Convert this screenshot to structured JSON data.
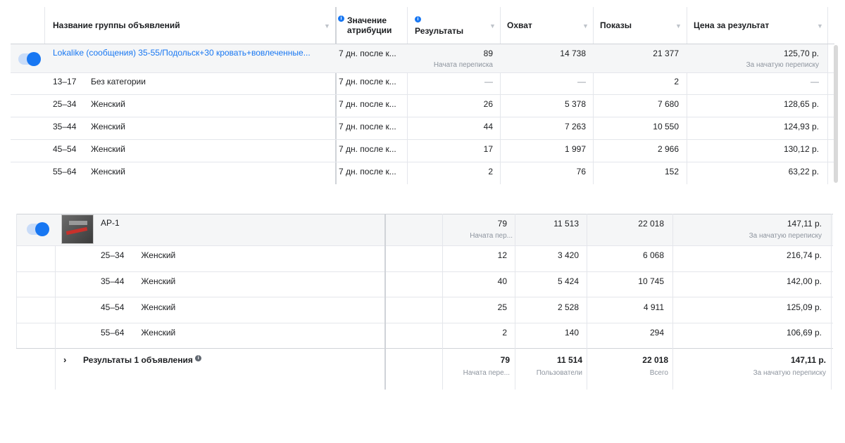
{
  "top_table": {
    "headers": {
      "name": "Название группы объявлений",
      "attribution": "Значение атрибуции",
      "results": "Результаты",
      "reach": "Охват",
      "impressions": "Показы",
      "cost": "Цена за результат"
    },
    "main_row": {
      "name": "Lokalike (сообщения) 35-55/Подольск+30 кровать+вовлеченные...",
      "attribution": "7 дн. после к...",
      "results": "89",
      "results_sub": "Начата переписка",
      "reach": "14 738",
      "impressions": "21 377",
      "cost": "125,70 р.",
      "cost_sub": "За начатую переписку"
    },
    "rows": [
      {
        "age": "13–17",
        "gender": "Без категории",
        "attribution": "7 дн. после к...",
        "results": "—",
        "reach": "—",
        "impressions": "2",
        "cost": "—"
      },
      {
        "age": "25–34",
        "gender": "Женский",
        "attribution": "7 дн. после к...",
        "results": "26",
        "reach": "5 378",
        "impressions": "7 680",
        "cost": "128,65 р."
      },
      {
        "age": "35–44",
        "gender": "Женский",
        "attribution": "7 дн. после к...",
        "results": "44",
        "reach": "7 263",
        "impressions": "10 550",
        "cost": "124,93 р."
      },
      {
        "age": "45–54",
        "gender": "Женский",
        "attribution": "7 дн. после к...",
        "results": "17",
        "reach": "1 997",
        "impressions": "2 966",
        "cost": "130,12 р."
      },
      {
        "age": "55–64",
        "gender": "Женский",
        "attribution": "7 дн. после к...",
        "results": "2",
        "reach": "76",
        "impressions": "152",
        "cost": "63,22 р."
      }
    ]
  },
  "bottom_table": {
    "main_row": {
      "name": "AP-1",
      "results": "79",
      "results_sub": "Начата пер...",
      "reach": "11 513",
      "impressions": "22 018",
      "cost": "147,11 р.",
      "cost_sub": "За начатую переписку"
    },
    "rows": [
      {
        "age": "25–34",
        "gender": "Женский",
        "results": "12",
        "reach": "3 420",
        "impressions": "6 068",
        "cost": "216,74 р."
      },
      {
        "age": "35–44",
        "gender": "Женский",
        "results": "40",
        "reach": "5 424",
        "impressions": "10 745",
        "cost": "142,00 р."
      },
      {
        "age": "45–54",
        "gender": "Женский",
        "results": "25",
        "reach": "2 528",
        "impressions": "4 911",
        "cost": "125,09 р."
      },
      {
        "age": "55–64",
        "gender": "Женский",
        "results": "2",
        "reach": "140",
        "impressions": "294",
        "cost": "106,69 р."
      }
    ],
    "summary": {
      "label": "Результаты 1 объявления",
      "results": "79",
      "results_sub": "Начата пере...",
      "reach": "11 514",
      "reach_sub": "Пользователи",
      "impressions": "22 018",
      "impressions_sub": "Всего",
      "cost": "147,11 р.",
      "cost_sub": "За начатую переписку"
    }
  },
  "icons": {
    "info": "info-icon",
    "sort": "caret-down-icon",
    "expand": "chevron-right-icon",
    "toggle": "toggle-on-icon"
  },
  "colors": {
    "accent": "#1877f2",
    "link": "#1877f2",
    "border": "#e4e6eb",
    "muted": "#8d949e"
  }
}
